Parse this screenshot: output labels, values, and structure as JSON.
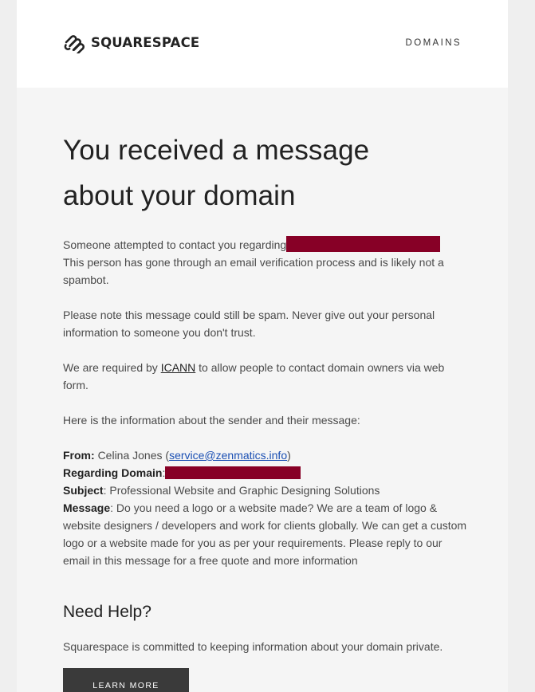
{
  "header": {
    "brand_name": "SQUARESPACE",
    "nav_link": "DOMAINS"
  },
  "message": {
    "title": "You received a message about your domain",
    "intro_prefix": "Someone attempted to contact you regarding",
    "intro_suffix": "This person has gone through an email verification process and is likely not a spambot.",
    "spam_note": "Please note this message could still be spam. Never give out your personal information to someone you don't trust.",
    "icann_prefix": "We are required by",
    "icann_link": "ICANN",
    "icann_suffix": "to allow people to contact domain owners via web form.",
    "sender_intro": "Here is the information about the sender and their message:"
  },
  "sender": {
    "from_label": "From:",
    "from_name": "Celina Jones",
    "from_email": "service@zenmatics.info",
    "regarding_label": "Regarding Domain",
    "subject_label": "Subject",
    "subject_value": ": Professional Website and Graphic Designing Solutions",
    "message_label": "Message",
    "message_value": ": Do you need a logo or a website made? We are a team of logo & website designers / developers and work for clients globally. We can get a custom logo or a website made for you as per your requirements. Please reply to our email in this message for a free quote and more information"
  },
  "help": {
    "heading": "Need Help?",
    "text": "Squarespace is committed to keeping information about your domain private.",
    "button_label": "LEARN MORE"
  },
  "colors": {
    "redaction": "#870026",
    "link": "#1a4fb3",
    "button_bg": "#3a3a3a",
    "body_bg": "#f5f5f5"
  }
}
